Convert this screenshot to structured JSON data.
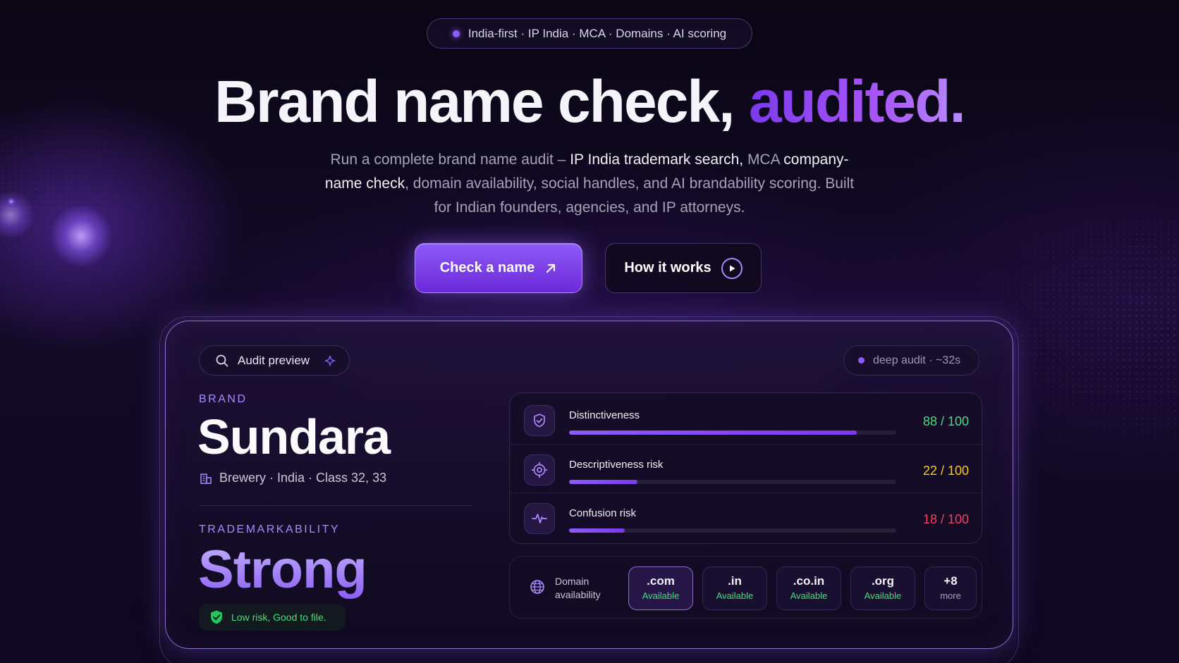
{
  "top_badge": {
    "text": "India-first · IP India · MCA · Domains · AI scoring"
  },
  "hero": {
    "title_main": "Brand name check,",
    "title_accent": "audited.",
    "subtitle_parts": [
      "Run a complete brand name audit – ",
      "IP India trademark search,",
      " MCA ",
      "company-name check",
      ", domain availability, social handles, and AI brandability scoring. Built for Indian founders, agencies, and IP attorneys."
    ],
    "cta_primary": "Check a name",
    "cta_secondary": "How it works"
  },
  "audit_card": {
    "preview_label": "Audit preview",
    "mode_label": "deep audit · ~32s",
    "brand_label": "BRAND",
    "brand_name": "Sundara",
    "brand_meta": "Brewery · India · Class 32, 33",
    "trademark_label": "TRADEMARKABILITY",
    "trademark_value": "Strong",
    "risk_text": "Low risk, Good to file.",
    "metrics": [
      {
        "label": "Distinctiveness",
        "score_text": "88 / 100",
        "fill": 0.88,
        "color": "#4ade80",
        "icon": "shield-check-icon"
      },
      {
        "label": "Descriptiveness risk",
        "score_text": "22 / 100",
        "fill": 0.21,
        "color": "#facc15",
        "icon": "target-icon"
      },
      {
        "label": "Confusion risk",
        "score_text": "18 / 100",
        "fill": 0.17,
        "color": "#f43f5e",
        "icon": "pulse-icon"
      }
    ],
    "domain_label_line1": "Domain",
    "domain_label_line2": "availability",
    "domains": [
      {
        "name": ".com",
        "status": "Available"
      },
      {
        "name": ".in",
        "status": "Available"
      },
      {
        "name": ".co.in",
        "status": "Available"
      },
      {
        "name": ".org",
        "status": "Available"
      },
      {
        "name": "+8",
        "status": "more"
      }
    ]
  },
  "colors": {
    "accent": "#8b5cf6",
    "success": "#4ade80",
    "warning": "#facc15",
    "danger": "#f43f5e"
  }
}
